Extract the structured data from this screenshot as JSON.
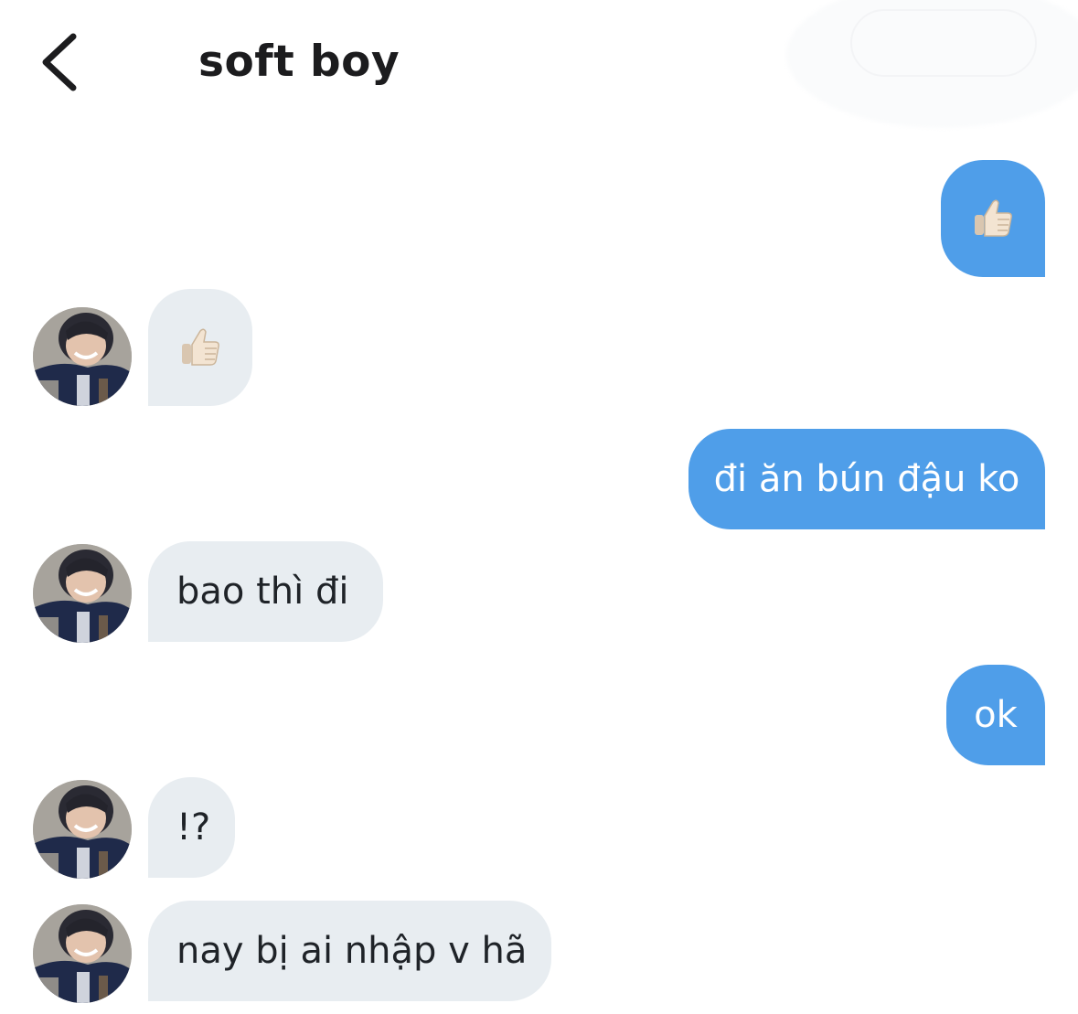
{
  "header": {
    "title": "soft boy",
    "back_icon": "chevron-left-icon"
  },
  "colors": {
    "outgoing_bubble": "#4f9ee9",
    "incoming_bubble": "#e8edf1",
    "outgoing_text": "#ffffff",
    "incoming_text": "#1f2328"
  },
  "messages": [
    {
      "direction": "outgoing",
      "type": "emoji",
      "content": "thumbs-up-icon"
    },
    {
      "direction": "incoming",
      "type": "emoji",
      "content": "thumbs-up-icon"
    },
    {
      "direction": "outgoing",
      "type": "text",
      "text": "đi ăn bún đậu ko"
    },
    {
      "direction": "incoming",
      "type": "text",
      "text": "bao thì đi"
    },
    {
      "direction": "outgoing",
      "type": "text",
      "text": "ok"
    },
    {
      "direction": "incoming",
      "type": "text",
      "text": "!?"
    },
    {
      "direction": "incoming",
      "type": "text",
      "text": "nay bị ai nhập v hã"
    }
  ]
}
